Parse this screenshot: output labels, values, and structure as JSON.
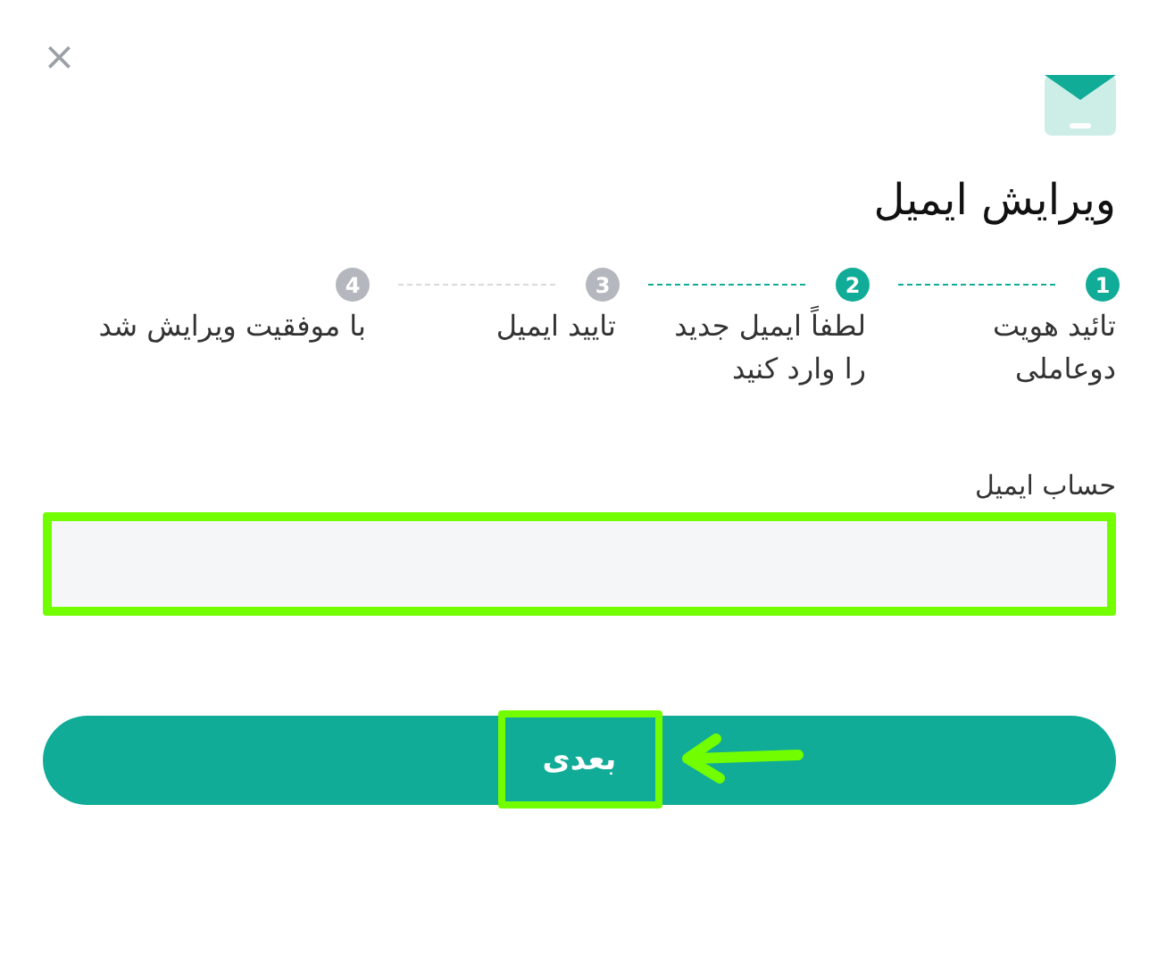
{
  "close": "×",
  "title": "ویرایش ایمیل",
  "steps": [
    {
      "number": "1",
      "label": "تائید هویت دوعاملی",
      "active": true
    },
    {
      "number": "2",
      "label": "لطفاً ایمیل جدید را وارد کنید",
      "active": true
    },
    {
      "number": "3",
      "label": "تایید ایمیل",
      "active": false
    },
    {
      "number": "4",
      "label": "با موفقیت ویرایش شد",
      "active": false
    }
  ],
  "email_field": {
    "label": "حساب ایمیل",
    "highlighted": true
  },
  "next_button": {
    "label": "بعدی",
    "highlighted": true
  }
}
